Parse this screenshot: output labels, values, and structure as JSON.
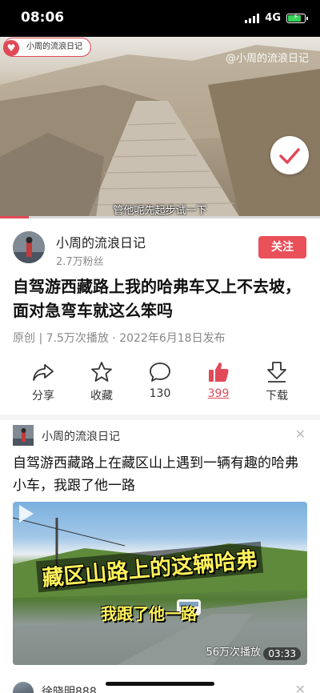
{
  "status_bar": {
    "time": "08:06",
    "network": "4G"
  },
  "video": {
    "channel_pill": "小周的流浪日记",
    "watermark": "@小周的流浪日记",
    "subtitle": "管他呢先起步试一下",
    "progress": 0.09
  },
  "author": {
    "name": "小周的流浪日记",
    "fans": "2.7万粉丝",
    "follow_label": "关注"
  },
  "article": {
    "title": "自驾游西藏路上我的哈弗车又上不去坡，面对急弯车就这么笨吗",
    "meta": "原创 | 7.5万次播放 · 2022年6月18日发布"
  },
  "actions": [
    {
      "icon": "share-icon",
      "label": "分享"
    },
    {
      "icon": "star-icon",
      "label": "收藏"
    },
    {
      "icon": "comment-icon",
      "label": "130"
    },
    {
      "icon": "thumbs-up-icon",
      "label": "399"
    },
    {
      "icon": "download-icon",
      "label": "下载"
    }
  ],
  "accent_color": "#e04a58",
  "recommended": {
    "author": "小周的流浪日记",
    "title": "自驾游西藏路上在藏区山上遇到一辆有趣的哈弗小车，我跟了他一路",
    "thumb_text_1": "藏区山路上的这辆哈弗",
    "thumb_text_2": "我跟了他一路",
    "views": "56万次播放",
    "duration": "03:33"
  },
  "next_item": {
    "author": "徐晓明888"
  }
}
